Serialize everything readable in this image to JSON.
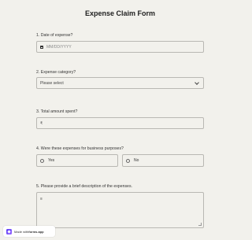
{
  "form": {
    "title": "Expense Claim Form"
  },
  "questions": {
    "q1": {
      "label": "1.  Date of expense?",
      "placeholder": "MM/DD/YYYY"
    },
    "q2": {
      "label": "2.  Expense category?",
      "selected": "Please select"
    },
    "q3": {
      "label": "3.  Total amount spent?",
      "currency_symbol": "₹"
    },
    "q4": {
      "label": "4.  Were these expenses for business purposes?",
      "options": [
        "Yes",
        "No"
      ]
    },
    "q5": {
      "label": "5.  Please provide a brief description of the expenses.",
      "icon_glyph": "≡"
    }
  },
  "badge": {
    "prefix": "Made with ",
    "brand": "forms.app"
  },
  "icons": {
    "date": "calendar-icon",
    "select": "chevron-down-icon",
    "textarea": "text-lines-icon",
    "brand": "forms-app-logo-icon"
  },
  "colors": {
    "background": "#f2f1ec",
    "border": "#b9b8b3",
    "brand": "#5b3df5"
  }
}
